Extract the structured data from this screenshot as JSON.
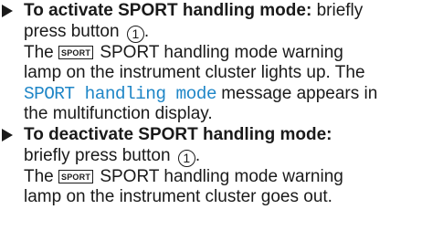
{
  "steps": [
    {
      "heading": "To activate SPORT handling mode:",
      "heading_tail": " briefly",
      "line2_pre": "press button",
      "button_num": "1",
      "line2_post": ".",
      "line3_pre": "The",
      "badge": "SPORT",
      "line3_post": "SPORT handling mode warning",
      "line4": "lamp on the instrument cluster lights up. The",
      "display_msg": "SPORT handling mode",
      "line5_post": " message appears in",
      "line6": "the multifunction display."
    },
    {
      "heading": "To deactivate SPORT handling mode:",
      "line2_pre": "briefly press button",
      "button_num": "1",
      "line2_post": ".",
      "line3_pre": "The",
      "badge": "SPORT",
      "line3_post": "SPORT handling mode warning",
      "line4": "lamp on the instrument cluster goes out."
    }
  ],
  "colors": {
    "text": "#1a1a1a",
    "display_message": "#1f86c7"
  }
}
